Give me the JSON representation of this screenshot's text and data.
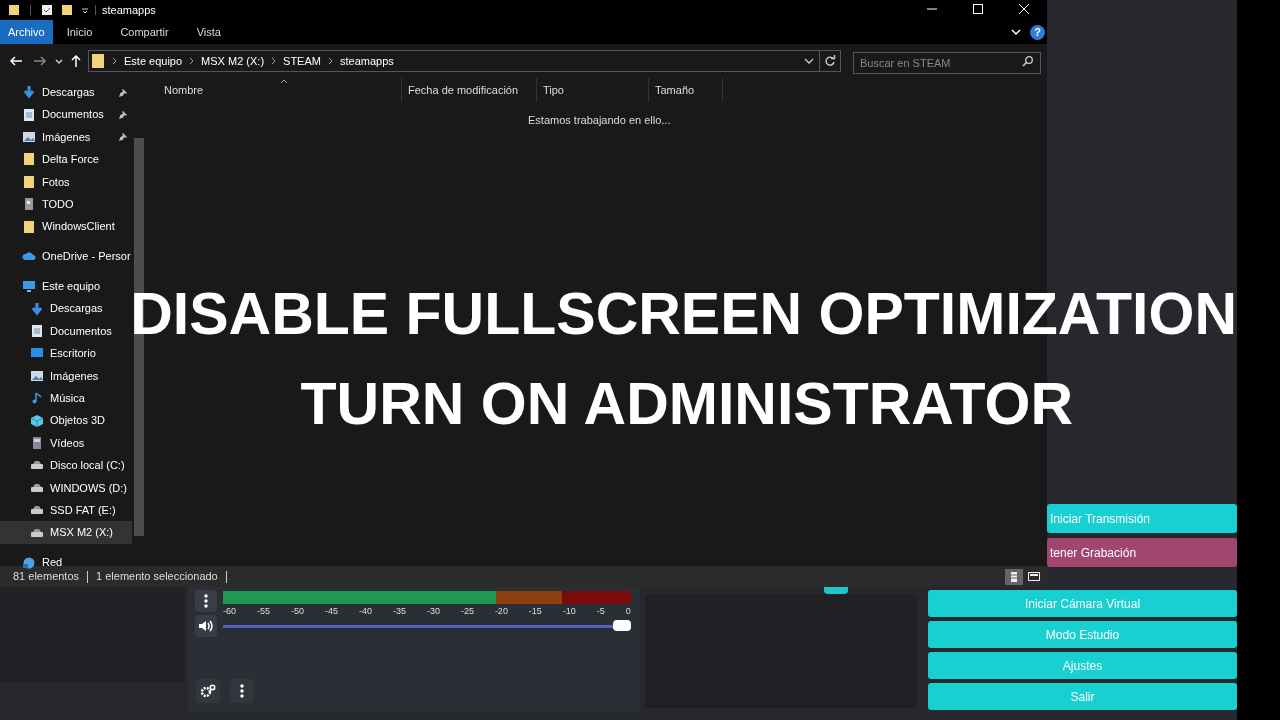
{
  "explorer": {
    "title": "steamapps",
    "ribbon_tabs": [
      {
        "label": "Archivo",
        "selected": true
      },
      {
        "label": "Inicio",
        "selected": false
      },
      {
        "label": "Compartir",
        "selected": false
      },
      {
        "label": "Vista",
        "selected": false
      }
    ],
    "help_button": "?",
    "breadcrumb": [
      "Este equipo",
      "MSX M2 (X:)",
      "STEAM",
      "steamapps"
    ],
    "search": {
      "placeholder": "Buscar en STEAM"
    },
    "sidebar": [
      {
        "label": "Descargas",
        "kind": "download",
        "pinned": true,
        "selected": false
      },
      {
        "label": "Documentos",
        "kind": "document",
        "pinned": true,
        "selected": false
      },
      {
        "label": "Imágenes",
        "kind": "image",
        "pinned": true,
        "selected": false
      },
      {
        "label": "Delta Force",
        "kind": "folder",
        "pinned": false,
        "selected": false
      },
      {
        "label": "Fotos",
        "kind": "folder",
        "pinned": false,
        "selected": false
      },
      {
        "label": "TODO",
        "kind": "file",
        "pinned": false,
        "selected": false
      },
      {
        "label": "WindowsClient",
        "kind": "folder",
        "pinned": false,
        "selected": false
      },
      {
        "label": "OneDrive - Persor",
        "kind": "cloud",
        "pinned": false,
        "selected": false
      },
      {
        "label": "Este equipo",
        "kind": "computer",
        "pinned": false,
        "selected": false,
        "children": [
          {
            "label": "Descargas",
            "kind": "download",
            "selected": false
          },
          {
            "label": "Documentos",
            "kind": "document",
            "selected": false
          },
          {
            "label": "Escritorio",
            "kind": "desktop",
            "selected": false
          },
          {
            "label": "Imágenes",
            "kind": "image",
            "selected": false
          },
          {
            "label": "Música",
            "kind": "music",
            "selected": false
          },
          {
            "label": "Objetos 3D",
            "kind": "objects",
            "selected": false
          },
          {
            "label": "Vídeos",
            "kind": "video",
            "selected": false
          },
          {
            "label": "Disco local (C:)",
            "kind": "drive",
            "selected": false
          },
          {
            "label": "WINDOWS (D:)",
            "kind": "drive",
            "selected": false
          },
          {
            "label": "SSD FAT (E:)",
            "kind": "drive",
            "selected": false
          },
          {
            "label": "MSX M2 (X:)",
            "kind": "drive",
            "selected": true
          }
        ]
      },
      {
        "label": "Red",
        "kind": "network",
        "pinned": false,
        "selected": false
      }
    ],
    "columns": [
      {
        "label": "Nombre",
        "sorted": true
      },
      {
        "label": "Fecha de modificación",
        "sorted": false
      },
      {
        "label": "Tipo",
        "sorted": false
      },
      {
        "label": "Tamaño",
        "sorted": false
      }
    ],
    "empty_message": "Estamos trabajando en ello...",
    "status_bar": {
      "count": "81 elementos",
      "selection": "1 elemento seleccionado"
    },
    "views": [
      {
        "kind": "details",
        "selected": true
      },
      {
        "kind": "tiles",
        "selected": false
      }
    ]
  },
  "mixer": {
    "scale": [
      "-60",
      "-55",
      "-50",
      "-45",
      "-40",
      "-35",
      "-30",
      "-25",
      "-20",
      "-15",
      "-10",
      "-5",
      "0"
    ],
    "volume": {
      "level": 1
    }
  },
  "controls": [
    {
      "label": "Iniciar Transmisión",
      "kind": "normal"
    },
    {
      "label": "tener Grabación",
      "kind": "active"
    },
    {
      "label": "Iniciar Cámara Virtual",
      "kind": "normal"
    },
    {
      "label": "Modo Estudio",
      "kind": "normal"
    },
    {
      "label": "Ajustes",
      "kind": "normal"
    },
    {
      "label": "Salir",
      "kind": "normal"
    }
  ],
  "caption": [
    "DISABLE FULLSCREEN OPTIMIZATION",
    "TURN ON ADMINISTRATOR"
  ]
}
